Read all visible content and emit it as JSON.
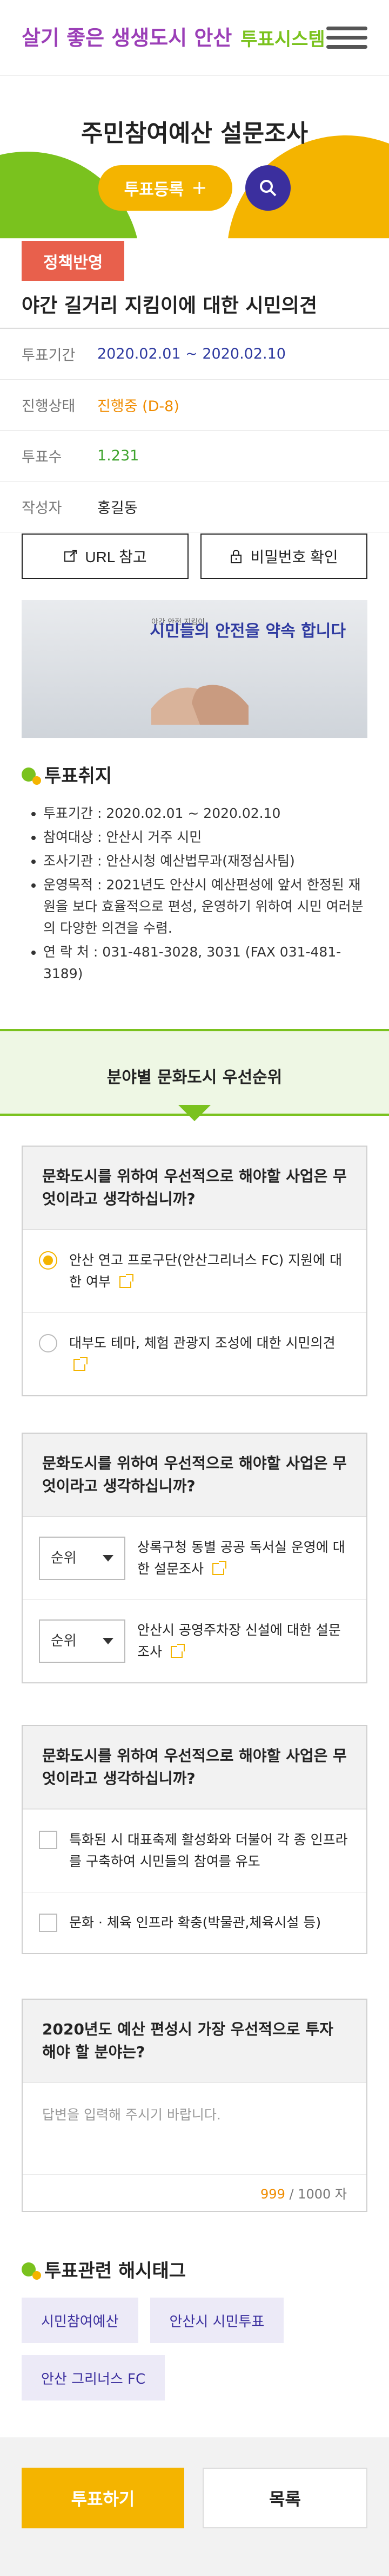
{
  "header": {
    "logo_mark": "살기 좋은 생생도시 안산",
    "logo_sub": "투표시스템",
    "menu_icon": "hamburger-icon"
  },
  "hero": {
    "title": "주민참여예산 설문조사",
    "register_label": "투표등록",
    "search_icon": "search-icon"
  },
  "badge": "정책반영",
  "vote": {
    "title": "야간 길거리 지킴이에 대한 시민의견",
    "meta": [
      {
        "k": "투표기간",
        "v": "2020.02.01 ~ 2020.02.10"
      },
      {
        "k": "진행상태",
        "v": "진행중 (D-8)"
      },
      {
        "k": "투표수",
        "v": "1.231"
      },
      {
        "k": "작성자",
        "v": "홍길동"
      }
    ]
  },
  "buttons": {
    "url": "URL 참고",
    "password": "비밀번호 확인"
  },
  "banner": {
    "headline": "시민들의 안전을 약속 합니다",
    "small": "야간 안전 지킴이"
  },
  "purpose": {
    "title": "투표취지",
    "items": [
      "투표기간 : 2020.02.01 ~ 2020.02.10",
      "참여대상 : 안산시 거주 시민",
      "조사기관 : 안산시청 예산법무과(재정심사팀)",
      "운영목적 : 2021년도 안산시 예산편성에 앞서 한정된 재원을 보다 효율적으로 편성, 운영하기 위하여 시민 여러분의 다양한 의견을 수렴.",
      "연 락 처 : 031-481-3028, 3031 (FAX 031-481-3189)"
    ]
  },
  "category": {
    "title": "분야별 문화도시 우선순위"
  },
  "q1": {
    "question": "문화도시를 위하여 우선적으로 해야할 사업은 무엇이라고 생각하십니까?",
    "options": [
      "안산 연고 프로구단(안산그리너스 FC) 지원에 대한 여부",
      "대부도 테마, 체험 관광지 조성에 대한 시민의견"
    ]
  },
  "q2": {
    "question": "문화도시를 위하여 우선적으로 해야할 사업은 무엇이라고 생각하십니까?",
    "rank_label": "순위",
    "options": [
      "상록구청 동별 공공 독서실 운영에 대한 설문조사",
      "안산시 공영주차장 신설에 대한 설문조사"
    ]
  },
  "q3": {
    "question": "문화도시를 위하여 우선적으로 해야할 사업은 무엇이라고 생각하십니까?",
    "options": [
      "특화된 시 대표축제 활성화와 더불어 각 종 인프라를 구축하여 시민들의 참여를 유도",
      "문화 · 체육 인프라 확충(박물관,체육시설 등)"
    ]
  },
  "q4": {
    "question": "2020년도 예산 편성시 가장 우선적으로 투자해야 할 분야는?",
    "placeholder": "답변을 입력해 주시기 바랍니다.",
    "count": "999",
    "max": "/ 1000 자"
  },
  "hashtags": {
    "title": "투표관련 해시태그",
    "tags": [
      "시민참여예산",
      "안산시 시민투표",
      "안산 그리너스 FC"
    ]
  },
  "footer": {
    "vote": "투표하기",
    "list": "목록"
  },
  "colors": {
    "accent": "#f4b400",
    "green": "#7ac21e",
    "navy": "#3b2f9e",
    "badge": "#e8604c"
  }
}
